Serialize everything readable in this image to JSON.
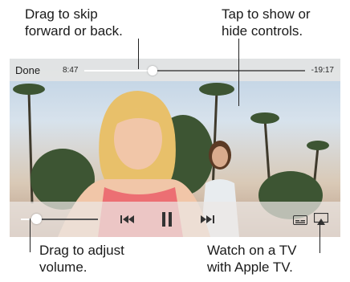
{
  "callouts": {
    "skip_line1": "Drag to skip",
    "skip_line2": "forward or back.",
    "tap_line1": "Tap to show or",
    "tap_line2": "hide controls.",
    "volume_line1": "Drag to adjust",
    "volume_line2": "volume.",
    "tv_line1": "Watch on a TV",
    "tv_line2": "with Apple TV."
  },
  "player": {
    "done_label": "Done",
    "elapsed": "8:47",
    "remaining": "-19:17",
    "progress_fraction": 0.31,
    "volume_fraction": 0.2
  },
  "icons": {
    "rewind": "rewind-icon",
    "pause": "pause-icon",
    "fast_forward": "fast-forward-icon",
    "subtitles": "subtitles-icon",
    "airplay": "airplay-icon"
  }
}
